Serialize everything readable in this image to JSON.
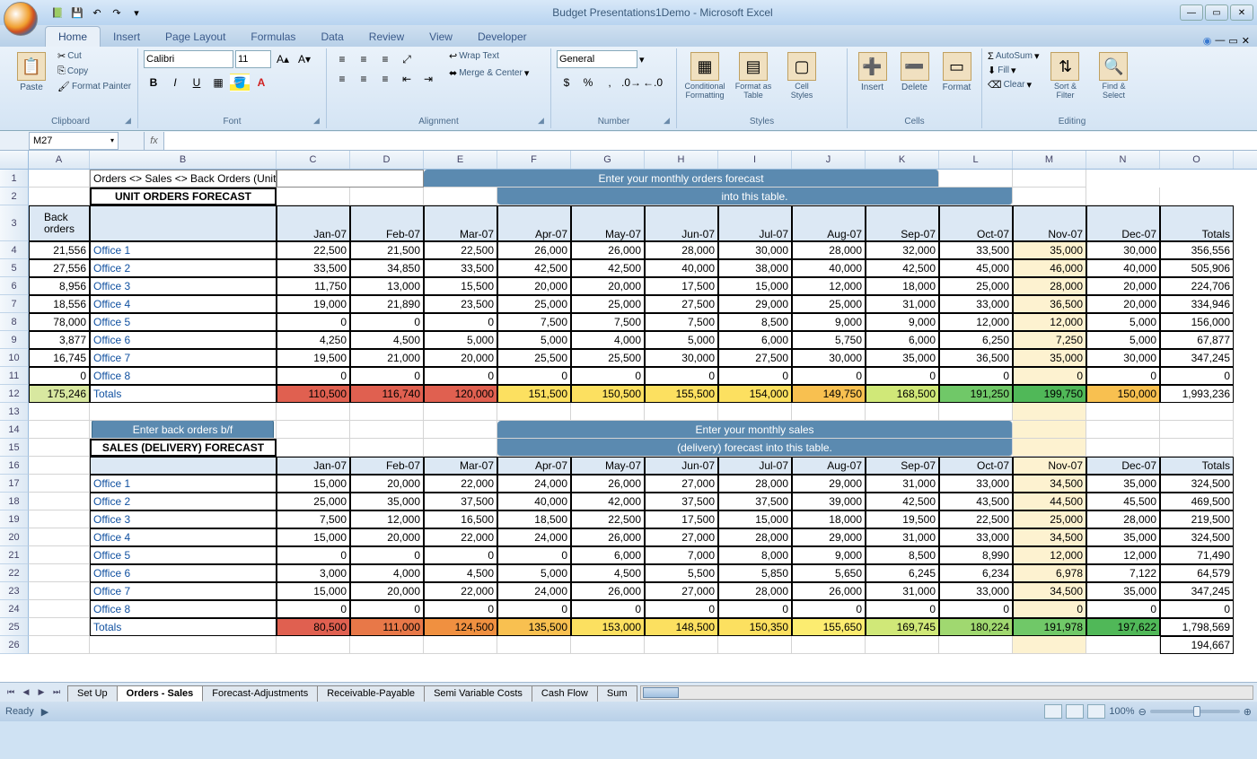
{
  "app": {
    "title": "Budget Presentations1Demo - Microsoft Excel",
    "status": "Ready",
    "zoom": "100%"
  },
  "nameBox": "M27",
  "formulaBar": "",
  "ribbonTabs": [
    "Home",
    "Insert",
    "Page Layout",
    "Formulas",
    "Data",
    "Review",
    "View",
    "Developer"
  ],
  "activeTab": "Home",
  "clipboard": {
    "paste": "Paste",
    "cut": "Cut",
    "copy": "Copy",
    "fp": "Format Painter",
    "label": "Clipboard"
  },
  "font": {
    "name": "Calibri",
    "size": "11",
    "label": "Font"
  },
  "alignment": {
    "wrap": "Wrap Text",
    "merge": "Merge & Center",
    "label": "Alignment"
  },
  "number": {
    "format": "General",
    "label": "Number"
  },
  "styles": {
    "cond": "Conditional Formatting",
    "fat": "Format as Table",
    "cs": "Cell Styles",
    "label": "Styles"
  },
  "cells": {
    "insert": "Insert",
    "delete": "Delete",
    "format": "Format",
    "label": "Cells"
  },
  "editing": {
    "autosum": "AutoSum",
    "fill": "Fill",
    "clear": "Clear",
    "sort": "Sort & Filter",
    "find": "Find & Select",
    "label": "Editing"
  },
  "columns": [
    "A",
    "B",
    "C",
    "D",
    "E",
    "F",
    "G",
    "H",
    "I",
    "J",
    "K",
    "L",
    "M",
    "N",
    "O"
  ],
  "months": [
    "Jan-07",
    "Feb-07",
    "Mar-07",
    "Apr-07",
    "May-07",
    "Jun-07",
    "Jul-07",
    "Aug-07",
    "Sep-07",
    "Oct-07",
    "Nov-07",
    "Dec-07",
    "Totals"
  ],
  "breadcrumb": "Orders <> Sales <> Back Orders (Units)",
  "section1": "UNIT ORDERS FORECAST",
  "section2": "SALES (DELIVERY) FORECAST",
  "callout1a": "Enter your monthly  orders forecast",
  "callout1b": "into this table.",
  "callout2a": "Enter your monthly sales",
  "callout2b": "(delivery) forecast into this table.",
  "callout3": "Enter back orders b/f",
  "backOrdersLabel": "Back orders",
  "totalsLabel": "Totals",
  "backOrders": [
    "21,556",
    "27,556",
    "8,956",
    "18,556",
    "78,000",
    "3,877",
    "16,745",
    "0"
  ],
  "boTotal": "175,246",
  "offices": [
    "Office 1",
    "Office 2",
    "Office 3",
    "Office 4",
    "Office 5",
    "Office 6",
    "Office 7",
    "Office 8"
  ],
  "ordersData": [
    [
      "22,500",
      "21,500",
      "22,500",
      "26,000",
      "26,000",
      "28,000",
      "30,000",
      "28,000",
      "32,000",
      "33,500",
      "35,000",
      "30,000",
      "356,556"
    ],
    [
      "33,500",
      "34,850",
      "33,500",
      "42,500",
      "42,500",
      "40,000",
      "38,000",
      "40,000",
      "42,500",
      "45,000",
      "46,000",
      "40,000",
      "505,906"
    ],
    [
      "11,750",
      "13,000",
      "15,500",
      "20,000",
      "20,000",
      "17,500",
      "15,000",
      "12,000",
      "18,000",
      "25,000",
      "28,000",
      "20,000",
      "224,706"
    ],
    [
      "19,000",
      "21,890",
      "23,500",
      "25,000",
      "25,000",
      "27,500",
      "29,000",
      "25,000",
      "31,000",
      "33,000",
      "36,500",
      "20,000",
      "334,946"
    ],
    [
      "0",
      "0",
      "0",
      "7,500",
      "7,500",
      "7,500",
      "8,500",
      "9,000",
      "9,000",
      "12,000",
      "12,000",
      "5,000",
      "156,000"
    ],
    [
      "4,250",
      "4,500",
      "5,000",
      "5,000",
      "4,000",
      "5,000",
      "6,000",
      "5,750",
      "6,000",
      "6,250",
      "7,250",
      "5,000",
      "67,877"
    ],
    [
      "19,500",
      "21,000",
      "20,000",
      "25,500",
      "25,500",
      "30,000",
      "27,500",
      "30,000",
      "35,000",
      "36,500",
      "35,000",
      "30,000",
      "347,245"
    ],
    [
      "0",
      "0",
      "0",
      "0",
      "0",
      "0",
      "0",
      "0",
      "0",
      "0",
      "0",
      "0",
      "0"
    ]
  ],
  "ordersTotals": [
    "110,500",
    "116,740",
    "120,000",
    "151,500",
    "150,500",
    "155,500",
    "154,000",
    "149,750",
    "168,500",
    "191,250",
    "199,750",
    "150,000",
    "1,993,236"
  ],
  "salesData": [
    [
      "15,000",
      "20,000",
      "22,000",
      "24,000",
      "26,000",
      "27,000",
      "28,000",
      "29,000",
      "31,000",
      "33,000",
      "34,500",
      "35,000",
      "324,500"
    ],
    [
      "25,000",
      "35,000",
      "37,500",
      "40,000",
      "42,000",
      "37,500",
      "37,500",
      "39,000",
      "42,500",
      "43,500",
      "44,500",
      "45,500",
      "469,500"
    ],
    [
      "7,500",
      "12,000",
      "16,500",
      "18,500",
      "22,500",
      "17,500",
      "15,000",
      "18,000",
      "19,500",
      "22,500",
      "25,000",
      "28,000",
      "219,500"
    ],
    [
      "15,000",
      "20,000",
      "22,000",
      "24,000",
      "26,000",
      "27,000",
      "28,000",
      "29,000",
      "31,000",
      "33,000",
      "34,500",
      "35,000",
      "324,500"
    ],
    [
      "0",
      "0",
      "0",
      "0",
      "6,000",
      "7,000",
      "8,000",
      "9,000",
      "8,500",
      "8,990",
      "12,000",
      "12,000",
      "71,490"
    ],
    [
      "3,000",
      "4,000",
      "4,500",
      "5,000",
      "4,500",
      "5,500",
      "5,850",
      "5,650",
      "6,245",
      "6,234",
      "6,978",
      "7,122",
      "64,579"
    ],
    [
      "15,000",
      "20,000",
      "22,000",
      "24,000",
      "26,000",
      "27,000",
      "28,000",
      "26,000",
      "31,000",
      "33,000",
      "34,500",
      "35,000",
      "347,245"
    ],
    [
      "0",
      "0",
      "0",
      "0",
      "0",
      "0",
      "0",
      "0",
      "0",
      "0",
      "0",
      "0",
      "0"
    ]
  ],
  "salesTotals": [
    "80,500",
    "111,000",
    "124,500",
    "135,500",
    "153,000",
    "148,500",
    "150,350",
    "155,650",
    "169,745",
    "180,224",
    "191,978",
    "197,622",
    "1,798,569"
  ],
  "row26val": "194,667",
  "heatOrders": [
    "heat1",
    "heat1",
    "heat1",
    "heat5",
    "heat5",
    "heat5",
    "heat5",
    "heat4",
    "heat8",
    "heat10",
    "heat11",
    "heat4"
  ],
  "heatSales": [
    "heat1",
    "heat2",
    "heat3",
    "heat4",
    "heat5",
    "heat5",
    "heat5",
    "heat6",
    "heat8",
    "heat9",
    "heat10",
    "heat11"
  ],
  "sheetTabs": [
    "Set Up",
    "Orders - Sales",
    "Forecast-Adjustments",
    "Receivable-Payable",
    "Semi Variable Costs",
    "Cash Flow",
    "Sum"
  ],
  "activeSheet": "Orders - Sales"
}
